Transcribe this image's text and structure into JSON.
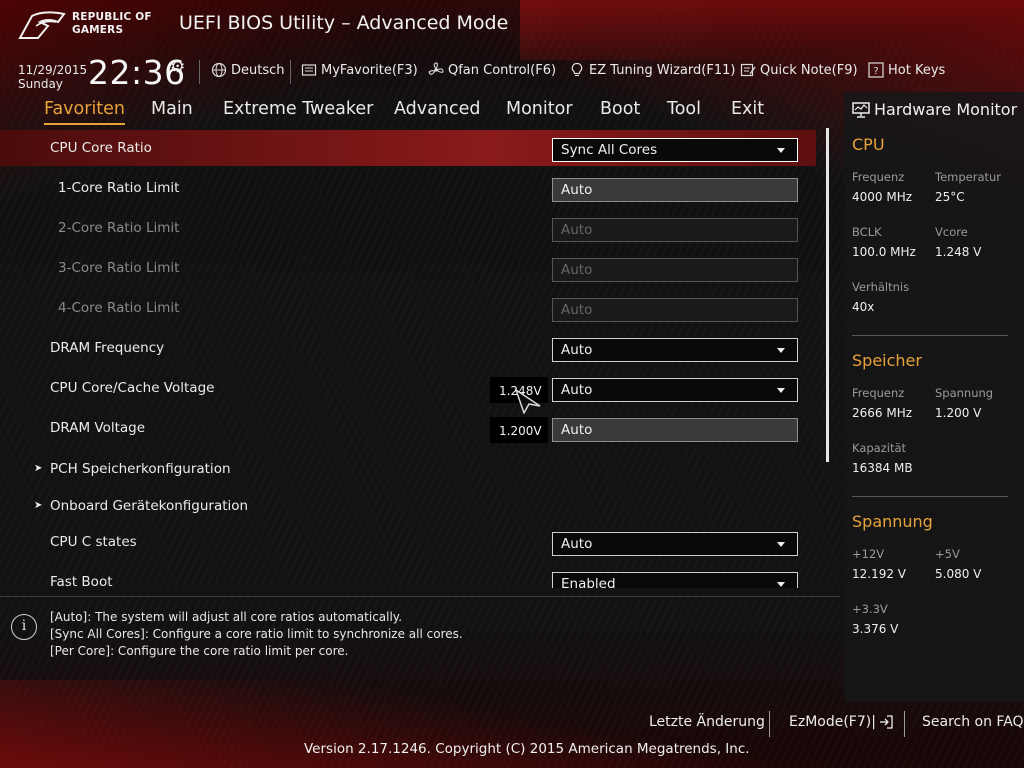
{
  "header": {
    "logo_line1": "REPUBLIC OF",
    "logo_line2": "GAMERS",
    "title": "UEFI BIOS Utility – Advanced Mode",
    "date": "11/29/2015",
    "day": "Sunday",
    "time": "22:36"
  },
  "toolbar": {
    "language": "Deutsch",
    "myfavorite": "MyFavorite(F3)",
    "qfan": "Qfan Control(F6)",
    "ez_tuning": "EZ Tuning Wizard(F11)",
    "quick_note": "Quick Note(F9)",
    "hot_keys": "Hot Keys"
  },
  "menu": [
    "Favoriten",
    "Main",
    "Extreme Tweaker",
    "Advanced",
    "Monitor",
    "Boot",
    "Tool",
    "Exit"
  ],
  "settings": {
    "cpu_core_ratio": {
      "label": "CPU Core Ratio",
      "value": "Sync All Cores"
    },
    "core1": {
      "label": "1-Core Ratio Limit",
      "value": "Auto"
    },
    "core2": {
      "label": "2-Core Ratio Limit",
      "value": "Auto"
    },
    "core3": {
      "label": "3-Core Ratio Limit",
      "value": "Auto"
    },
    "core4": {
      "label": "4-Core Ratio Limit",
      "value": "Auto"
    },
    "dram_freq": {
      "label": "DRAM Frequency",
      "value": "Auto"
    },
    "cpu_voltage": {
      "label": "CPU Core/Cache Voltage",
      "reading": "1.248V",
      "value": "Auto"
    },
    "dram_voltage": {
      "label": "DRAM Voltage",
      "reading": "1.200V",
      "value": "Auto"
    },
    "pch": {
      "label": "PCH Speicherkonfiguration"
    },
    "onboard": {
      "label": "Onboard Gerätekonfiguration"
    },
    "c_states": {
      "label": "CPU C states",
      "value": "Auto"
    },
    "fast_boot": {
      "label": "Fast Boot",
      "value": "Enabled"
    }
  },
  "help": [
    "[Auto]: The system will adjust all core ratios automatically.",
    "[Sync All Cores]: Configure a core ratio limit to synchronize all cores.",
    "[Per Core]: Configure the core ratio limit per core."
  ],
  "hardware_monitor": {
    "title": "Hardware Monitor",
    "cpu": {
      "heading": "CPU",
      "freq_label": "Frequenz",
      "freq": "4000 MHz",
      "temp_label": "Temperatur",
      "temp": "25°C",
      "bclk_label": "BCLK",
      "bclk": "100.0 MHz",
      "vcore_label": "Vcore",
      "vcore": "1.248 V",
      "ratio_label": "Verhältnis",
      "ratio": "40x"
    },
    "memory": {
      "heading": "Speicher",
      "freq_label": "Frequenz",
      "freq": "2666 MHz",
      "volt_label": "Spannung",
      "volt": "1.200 V",
      "cap_label": "Kapazität",
      "cap": "16384 MB"
    },
    "voltage": {
      "heading": "Spannung",
      "v12_label": "+12V",
      "v12": "12.192 V",
      "v5_label": "+5V",
      "v5": "5.080 V",
      "v33_label": "+3.3V",
      "v33": "3.376 V"
    }
  },
  "footer": {
    "last_change": "Letzte Änderung",
    "ezmode": "EzMode(F7)|",
    "faq": "Search on FAQ",
    "version": "Version 2.17.1246. Copyright (C) 2015 American Megatrends, Inc."
  },
  "colors": {
    "accent": "#e8a33a",
    "highlight_row": "#8a1a1a"
  }
}
